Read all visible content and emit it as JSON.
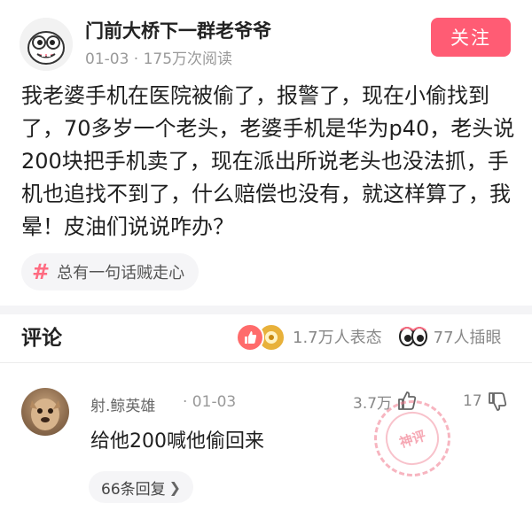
{
  "author": {
    "name": "门前大桥下一群老爷爷",
    "meta": "01-03 · 175万次阅读",
    "follow_label": "关注"
  },
  "post": {
    "text": "我老婆手机在医院被偷了，报警了，现在小偷找到了，70多岁一个老头，老婆手机是华为p40，老头说200块把手机卖了，现在派出所说老头也没法抓，手机也追找不到了，什么赔偿也没有，就这样算了，我晕！皮油们说说咋办？"
  },
  "topic": {
    "label": "总有一句话贼走心"
  },
  "comments_section": {
    "title": "评论",
    "reactions_label": "1.7万人表态",
    "watchers_label": "77人插眼"
  },
  "comment": {
    "username": "射.鲸英雄",
    "date": "· 01-03",
    "likes": "3.7万",
    "dislikes": "17",
    "text": "给他200喊他偷回来",
    "stamp_label": "神评",
    "replies_label": "66条回复"
  },
  "colors": {
    "accent": "#ff5c74",
    "muted": "#999999"
  },
  "icons": [
    "like-icon",
    "gold-badge-icon",
    "eyes-icon",
    "thumb-up-icon",
    "thumb-down-icon",
    "chevron-right-icon"
  ]
}
